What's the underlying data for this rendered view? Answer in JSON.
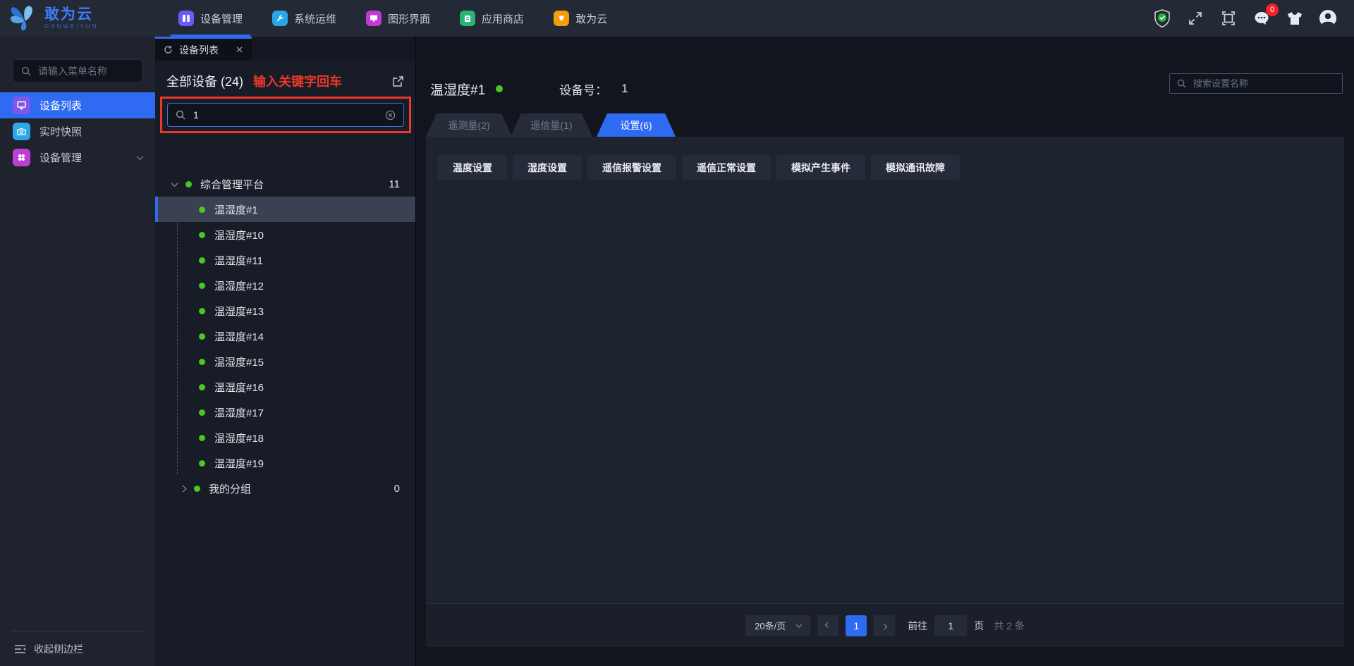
{
  "topbar": {
    "logo_title": "敢为云",
    "logo_subtitle": "GANWEIYUN",
    "nav": [
      {
        "label": "设备管理",
        "color": "#6a5af9"
      },
      {
        "label": "系统运维",
        "color": "#29a6e8"
      },
      {
        "label": "图形界面",
        "color": "#c13ad6"
      },
      {
        "label": "应用商店",
        "color": "#27b474"
      },
      {
        "label": "敢为云",
        "color": "#f59b0c"
      }
    ],
    "message_badge": "0"
  },
  "sidebar": {
    "search_placeholder": "请输入菜单名称",
    "items": [
      {
        "label": "设备列表"
      },
      {
        "label": "实时快照"
      },
      {
        "label": "设备管理"
      }
    ],
    "collapse_label": "收起侧边栏"
  },
  "device_panel": {
    "tab_label": "设备列表",
    "all_devices_label": "全部设备 (24)",
    "annotation_text": "输入关键字回车",
    "search_value": "1",
    "tree": {
      "root_label": "综合管理平台",
      "root_count": "11",
      "devices": [
        "温湿度#1",
        "温湿度#10",
        "温湿度#11",
        "温湿度#12",
        "温湿度#13",
        "温湿度#14",
        "温湿度#15",
        "温湿度#16",
        "温湿度#17",
        "温湿度#18",
        "温湿度#19"
      ],
      "group_label": "我的分组",
      "group_count": "0"
    }
  },
  "main": {
    "device_title": "温湿度#1",
    "device_no_label": "设备号：",
    "device_no_value": "1",
    "search_placeholder": "搜索设置名称",
    "tabs": [
      {
        "label": "遥测量(2)"
      },
      {
        "label": "遥信量(1)"
      },
      {
        "label": "设置(6)"
      }
    ],
    "buttons": [
      "温度设置",
      "湿度设置",
      "遥信报警设置",
      "遥信正常设置",
      "模拟产生事件",
      "模拟通讯故障"
    ],
    "pagination": {
      "page_size": "20条/页",
      "current_page": "1",
      "goto_label": "前往",
      "goto_value": "1",
      "page_label": "页",
      "total_label": "共 2 条"
    }
  },
  "colors": {
    "accent_blue": "#2e6bf2",
    "annotation_red": "#e8392b",
    "status_green": "#49c628",
    "badge_red": "#f5222d"
  }
}
